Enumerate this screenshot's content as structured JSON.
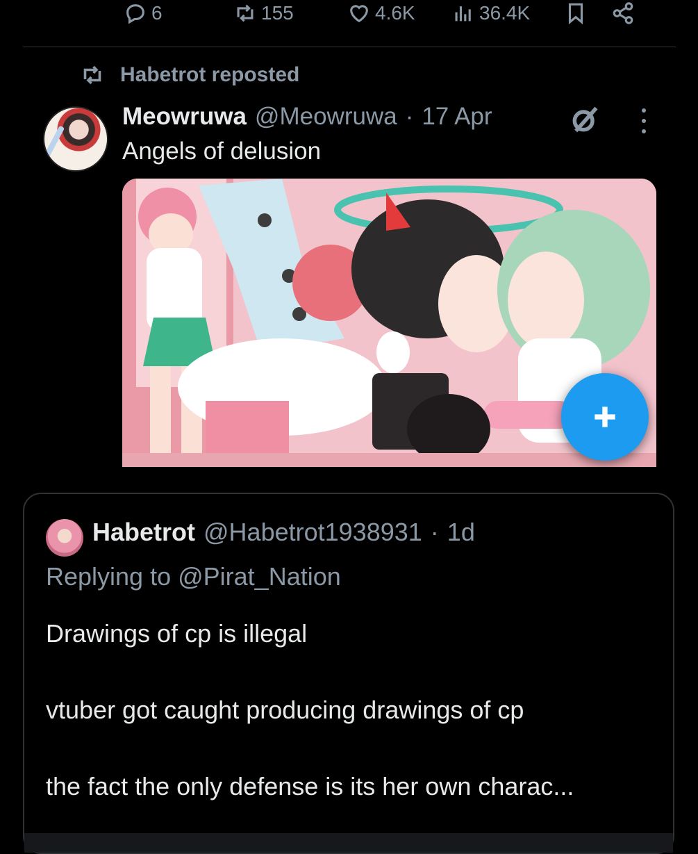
{
  "engagement": {
    "replies": "6",
    "reposts": "155",
    "likes": "4.6K",
    "views": "36.4K"
  },
  "repost_banner": {
    "text": "Habetrot reposted"
  },
  "tweet": {
    "author_name": "Meowruwa",
    "handle": "@Meowruwa",
    "separator": "·",
    "time": "17 Apr",
    "text": "Angels of delusion"
  },
  "quoted": {
    "author_name": "Habetrot",
    "handle": "@Habetrot1938931",
    "separator": "·",
    "time": "1d",
    "reply_to": "Replying to @Pirat_Nation",
    "paragraphs": [
      "Drawings of cp is illegal",
      "vtuber got caught producing drawings of cp",
      "the fact the only defense is its her own charac..."
    ]
  },
  "fab": {
    "icon": "plus-icon"
  },
  "colors": {
    "background": "#000000",
    "text": "#e7e9ea",
    "secondary": "#8b98a5",
    "accent": "#1d9bf0",
    "border": "#2f3336"
  }
}
